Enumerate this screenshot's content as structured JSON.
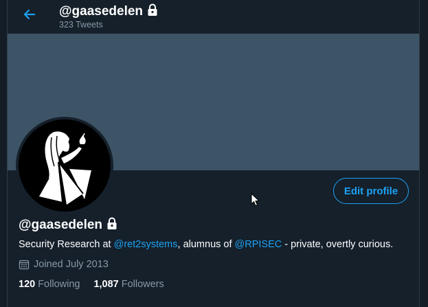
{
  "header": {
    "handle": "@gaasedelen",
    "tweet_count": "323 Tweets"
  },
  "profile": {
    "name": "@gaasedelen",
    "bio": {
      "part1": "Security Research at ",
      "link1": "@ret2systems",
      "part2": ", alumnus of ",
      "link2": "@RPISEC",
      "part3": " - private, overtly curious."
    },
    "joined": "Joined July 2013",
    "following": {
      "count": "120",
      "label": "Following"
    },
    "followers": {
      "count": "1,087",
      "label": "Followers"
    },
    "edit_label": "Edit profile"
  },
  "icons": {
    "back": "arrow-left-icon",
    "lock": "lock-icon",
    "calendar": "calendar-icon"
  },
  "colors": {
    "background": "#15202b",
    "banner": "#3d5466",
    "accent": "#1da1f2",
    "muted": "#8899a6"
  }
}
